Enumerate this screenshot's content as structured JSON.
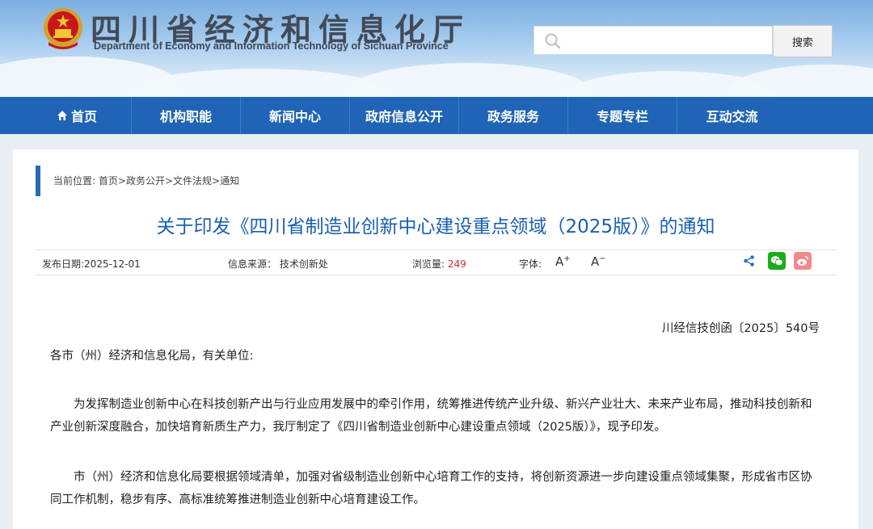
{
  "header": {
    "title": "四川省经济和信息化厅",
    "subtitle": "Department of Economy and Information Technology of Sichuan Province",
    "search_placeholder": "",
    "search_button": "搜索"
  },
  "nav": {
    "items": [
      {
        "label": "首页",
        "icon": "home-icon"
      },
      {
        "label": "机构职能"
      },
      {
        "label": "新闻中心"
      },
      {
        "label": "政府信息公开"
      },
      {
        "label": "政务服务"
      },
      {
        "label": "专题专栏"
      },
      {
        "label": "互动交流"
      }
    ]
  },
  "breadcrumb": {
    "prefix": "当前位置:",
    "items": [
      "首页",
      "政务公开",
      "文件法规",
      "通知"
    ]
  },
  "article": {
    "title": "关于印发《四川省制造业创新中心建设重点领域（2025版）》的通知",
    "meta": {
      "date_label": "发布日期:",
      "date": "2025-12-01",
      "source_label": "信息来源：",
      "source": "技术创新处",
      "views_label": "浏览量:",
      "views": "249",
      "font_label": "字体:",
      "font_increase": "A",
      "font_decrease": "A"
    },
    "doc_number": "川经信技创函〔2025〕540号",
    "salutation": "各市（州）经济和信息化局，有关单位:",
    "paragraphs": [
      "为发挥制造业创新中心在科技创新产出与行业应用发展中的牵引作用，统筹推进传统产业升级、新兴产业壮大、未来产业布局，推动科技创新和产业创新深度融合，加快培育新质生产力，我厅制定了《四川省制造业创新中心建设重点领域（2025版）》，现予印发。",
      "市（州）经济和信息化局要根据领域清单，加强对省级制造业创新中心培育工作的支持，将创新资源进一步向建设重点领域集聚，形成省市区协同工作机制，稳步有序、高标准统筹推进制造业创新中心培育建设工作。"
    ]
  },
  "colors": {
    "nav_bg": "#1f64b6",
    "title_blue": "#1b5fb2",
    "views_red": "#d8232a",
    "wechat_green": "#1aad19",
    "weibo_pink": "#f08a8a"
  }
}
